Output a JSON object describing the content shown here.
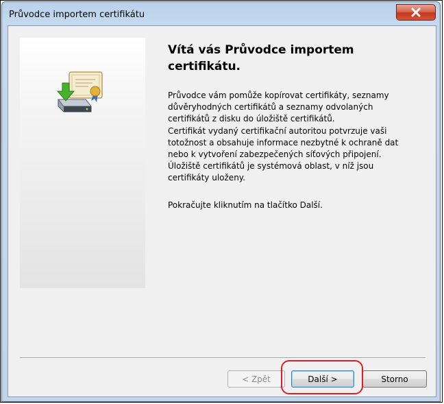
{
  "window": {
    "title": "Průvodce importem certifikátu",
    "close_icon": "close-icon"
  },
  "wizard": {
    "icon": "certificate-import-icon",
    "heading": "Vítá vás Průvodce importem certifikátu.",
    "paragraph1": "Průvodce vám pomůže kopírovat certifikáty, seznamy důvěryhodných certifikátů a seznamy odvolaných certifikátů z disku do úložiště certifikátů.",
    "paragraph2": "Certifikát vydaný certifikační autoritou potvrzuje vaši totožnost a obsahuje informace nezbytné k ochraně dat nebo k vytvoření zabezpečených síťových připojení. Úložiště certifikátů je systémová oblast, v níž jsou certifikáty uloženy.",
    "paragraph3": "Pokračujte kliknutím na tlačítko Další."
  },
  "buttons": {
    "back_label": "< Zpět",
    "next_label": "Další >",
    "cancel_label": "Storno"
  },
  "colors": {
    "highlight": "#e11b22",
    "close_button": "#c4351a",
    "titlebar": "#b9d1ea"
  }
}
